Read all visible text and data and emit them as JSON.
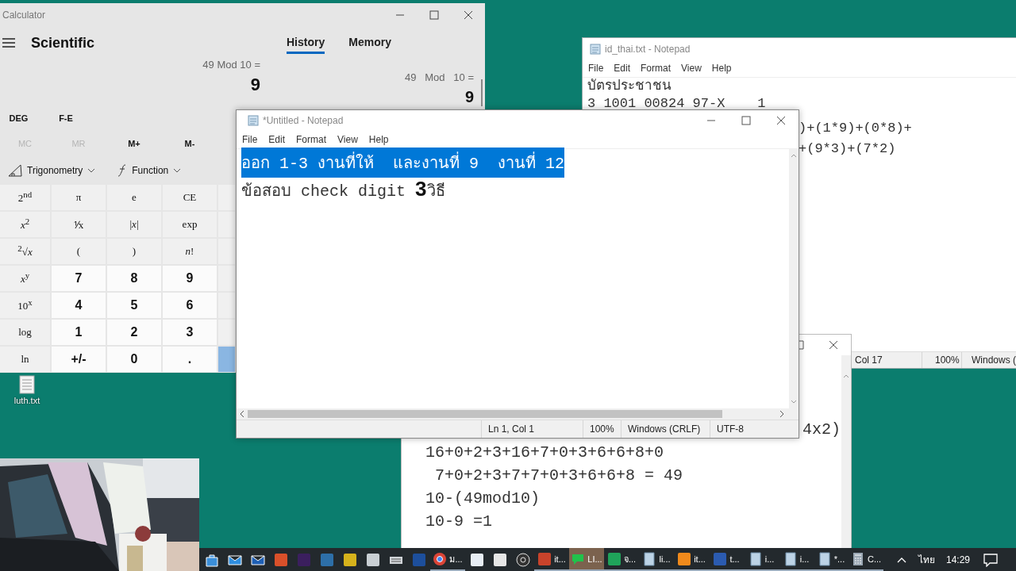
{
  "desktop": {
    "icons": [
      {
        "label": "luth.txt"
      }
    ]
  },
  "calculator": {
    "title": "Calculator",
    "mode": "Scientific",
    "tabs": [
      {
        "label": "History",
        "selected": true
      },
      {
        "label": "Memory",
        "selected": false
      }
    ],
    "expression": "49 Mod 10 =",
    "result": "9",
    "history": [
      {
        "expression": "49   Mod   10 =",
        "result": "9"
      }
    ],
    "toggles": [
      "DEG",
      "F-E"
    ],
    "memory_buttons": [
      {
        "label": "MC",
        "disabled": true
      },
      {
        "label": "MR",
        "disabled": true
      },
      {
        "label": "M+",
        "disabled": false
      },
      {
        "label": "M-",
        "disabled": false
      }
    ],
    "dropdowns": [
      {
        "label": "Trigonometry",
        "kind": "trig"
      },
      {
        "label": "Function",
        "kind": "func"
      }
    ],
    "keys": [
      {
        "label": "2$^{nd}$",
        "kind": "fn"
      },
      {
        "label": "π",
        "kind": "fn"
      },
      {
        "label": "e",
        "kind": "fn"
      },
      {
        "label": "CE",
        "kind": "fn"
      },
      {
        "kind": "blank"
      },
      {
        "label": "*x*$^{2}$",
        "kind": "fn"
      },
      {
        "label": "⅟x",
        "kind": "fn"
      },
      {
        "label": "|*x*|",
        "kind": "fn"
      },
      {
        "label": "exp",
        "kind": "fn"
      },
      {
        "kind": "blank"
      },
      {
        "label": "$^{2}$√*x*",
        "kind": "fn"
      },
      {
        "label": "(",
        "kind": "fn"
      },
      {
        "label": ")",
        "kind": "fn"
      },
      {
        "label": "*n*!",
        "kind": "fn"
      },
      {
        "kind": "blank"
      },
      {
        "label": "*x*$^{y}$",
        "kind": "fn"
      },
      {
        "label": "7",
        "kind": "num"
      },
      {
        "label": "8",
        "kind": "num"
      },
      {
        "label": "9",
        "kind": "num"
      },
      {
        "kind": "blank"
      },
      {
        "label": "10$^{x}$",
        "kind": "fn"
      },
      {
        "label": "4",
        "kind": "num"
      },
      {
        "label": "5",
        "kind": "num"
      },
      {
        "label": "6",
        "kind": "num"
      },
      {
        "kind": "blank"
      },
      {
        "label": "log",
        "kind": "fn"
      },
      {
        "label": "1",
        "kind": "num"
      },
      {
        "label": "2",
        "kind": "num"
      },
      {
        "label": "3",
        "kind": "num"
      },
      {
        "kind": "blank"
      },
      {
        "label": "ln",
        "kind": "fn"
      },
      {
        "label": "+/-",
        "kind": "num"
      },
      {
        "label": "0",
        "kind": "num"
      },
      {
        "label": ".",
        "kind": "num"
      },
      {
        "kind": "equals"
      }
    ]
  },
  "notepad_id": {
    "title": "id_thai.txt - Notepad",
    "menu": [
      "File",
      "Edit",
      "Format",
      "View",
      "Help"
    ],
    "lines": [
      {
        "text": "บัตรประชาชน",
        "kind": "full"
      },
      {
        "text": "3 1001 00824 97-X    1",
        "kind": "full"
      },
      {
        "text": ")+(1*9)+(0*8)+",
        "kind": "tail"
      },
      {
        "text": "+(9*3)+(7*2)",
        "kind": "tail"
      }
    ],
    "status": [
      "Col 17",
      "100%",
      "Windows ("
    ]
  },
  "notepad_back": {
    "lines": [
      {
        "text": "4x2)",
        "kind": "tail"
      },
      {
        "text": "16+0+2+3+16+7+0+3+6+6+8+0",
        "kind": "full"
      },
      {
        "text": " 7+0+2+3+7+7+0+3+6+6+8 = 49",
        "kind": "full"
      },
      {
        "text": "10-(49mod10)",
        "kind": "full"
      },
      {
        "text": "10-9 =1",
        "kind": "full"
      }
    ]
  },
  "notepad_front": {
    "title": "*Untitled - Notepad",
    "menu": [
      "File",
      "Edit",
      "Format",
      "View",
      "Help"
    ],
    "lines": [
      {
        "selected": true,
        "segments": [
          {
            "text": "ออก 1-3 งานที่ให้  และงานที่ 9  งานที่ 12",
            "kind": "plain"
          }
        ]
      },
      {
        "selected": false,
        "segments": [
          {
            "text": "ข้อสอบ check digit ",
            "kind": "plain"
          },
          {
            "text": "3",
            "kind": "large"
          },
          {
            "text": "วิธี",
            "kind": "plain"
          }
        ]
      }
    ],
    "status": [
      "Ln 1, Col 1",
      "100%",
      "Windows (CRLF)",
      "UTF-8"
    ]
  },
  "taskbar": {
    "items": [
      {
        "kind": "bag",
        "active": false
      },
      {
        "kind": "mail",
        "active": false
      },
      {
        "kind": "mail2",
        "active": false
      },
      {
        "kind": "tool",
        "active": false
      },
      {
        "kind": "pr",
        "active": false
      },
      {
        "kind": "box",
        "active": false
      },
      {
        "kind": "sync",
        "active": false
      },
      {
        "kind": "grid",
        "active": false
      },
      {
        "kind": "keyboard",
        "active": false
      },
      {
        "kind": "div",
        "active": false
      },
      {
        "kind": "chrome",
        "label": "ม...",
        "active": false
      },
      {
        "kind": "card",
        "active": false
      },
      {
        "kind": "dino",
        "active": false
      },
      {
        "kind": "obs",
        "active": false
      },
      {
        "kind": "ppt",
        "label": "it...",
        "active": false
      },
      {
        "kind": "line",
        "label": "LI...",
        "active": true
      },
      {
        "kind": "sheet",
        "label": "จ...",
        "active": false
      },
      {
        "kind": "notepad",
        "label": "li...",
        "active": false
      },
      {
        "kind": "orange",
        "label": "it...",
        "active": false
      },
      {
        "kind": "word",
        "label": "t...",
        "active": false
      },
      {
        "kind": "notepad",
        "label": "i...",
        "active": false
      },
      {
        "kind": "notepad",
        "label": "i...",
        "active": false
      },
      {
        "kind": "notepad",
        "label": "*...",
        "active": false
      },
      {
        "kind": "calc",
        "label": "C...",
        "active": false
      }
    ],
    "language": "ไทย",
    "time": "14:29"
  }
}
